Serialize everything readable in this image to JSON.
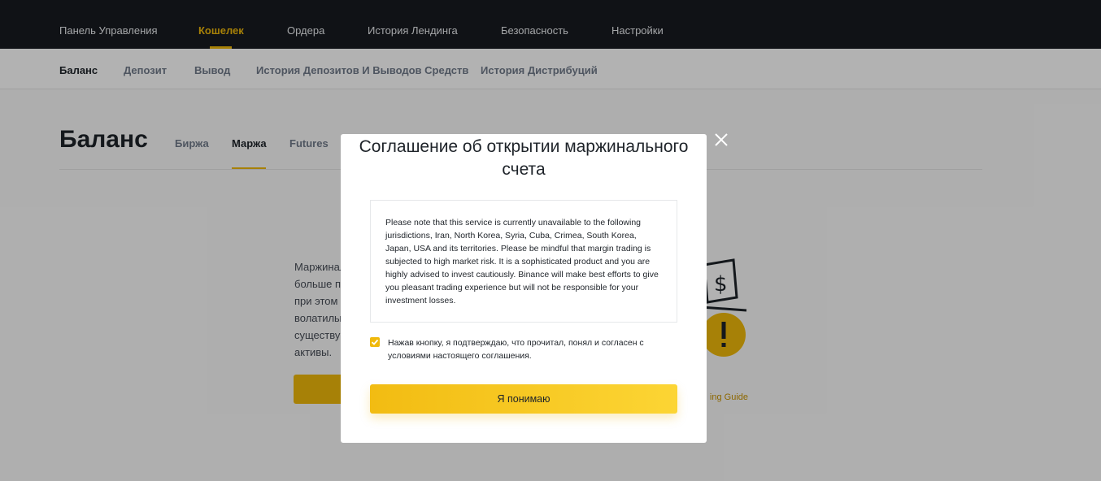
{
  "topnav": {
    "items": [
      "Панель Управления",
      "Кошелек",
      "Ордера",
      "История Лендинга",
      "Безопасность",
      "Настройки"
    ],
    "active_index": 1
  },
  "subnav": {
    "items": [
      "Баланс",
      "Депозит",
      "Вывод",
      "История Депозитов И Выводов Средств",
      "История Дистрибуций"
    ],
    "active_index": 0
  },
  "page": {
    "title": "Баланс",
    "tabs": [
      "Биржа",
      "Маржа",
      "Futures"
    ],
    "active_tab_index": 1,
    "intro_lines": [
      "Маржинал",
      "больше пр",
      "при этом ",
      "волатилы",
      "существу",
      "активы."
    ],
    "guide_link": "ing Guide"
  },
  "modal": {
    "title": "Соглашение об открытии маржинального счета",
    "notice": "Please note that this service is currently unavailable to the following jurisdictions, Iran, North Korea, Syria, Cuba, Crimea, South Korea, Japan, USA and its territories. Please be mindful that margin trading is subjected to high market risk. It is a sophisticated product and you are highly advised to invest cautiously. Binance will make best efforts to give you pleasant trading experience but will not be responsible for your investment losses.",
    "checkbox_checked": true,
    "agree_text": "Нажав кнопку, я подтверждаю, что прочитал, понял и согласен с условиями настоящего соглашения.",
    "confirm_label": "Я понимаю"
  },
  "colors": {
    "accent": "#f0b90b",
    "topbar": "#181a20",
    "overlay": "rgba(0,0,0,0.30)"
  },
  "icons": {
    "close": "close-icon",
    "checkbox": "checkmark-icon",
    "illustration": "dollar-warning-illustration"
  }
}
